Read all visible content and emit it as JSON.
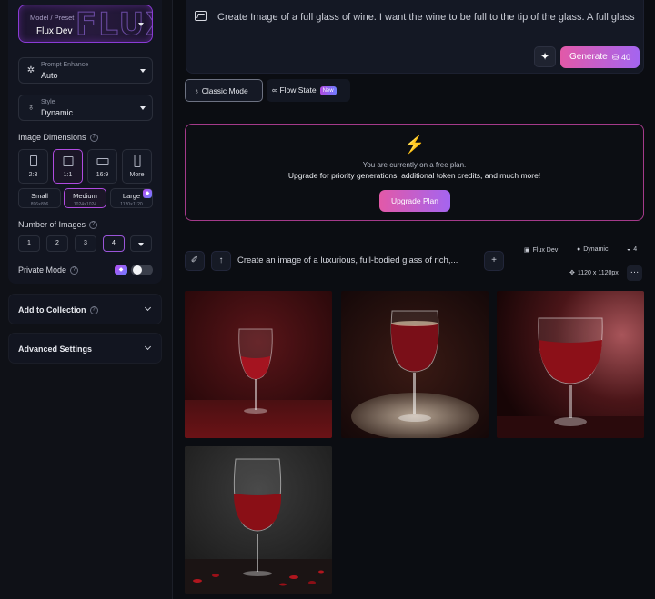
{
  "sidebar": {
    "model": {
      "label": "Model / Preset",
      "value": "Flux Dev"
    },
    "prompt_enhance": {
      "label": "Prompt Enhance",
      "value": "Auto"
    },
    "style": {
      "label": "Style",
      "value": "Dynamic"
    },
    "image_dimensions": {
      "title": "Image Dimensions",
      "ratios": [
        {
          "label": "2:3",
          "active": false
        },
        {
          "label": "1:1",
          "active": true
        },
        {
          "label": "16:9",
          "active": false
        },
        {
          "label": "More",
          "active": false
        }
      ],
      "sizes": [
        {
          "label": "Small",
          "px": "896×896",
          "active": false
        },
        {
          "label": "Medium",
          "px": "1024×1024",
          "active": true
        },
        {
          "label": "Large",
          "px": "1120×1120",
          "active": false
        }
      ]
    },
    "number_of_images": {
      "title": "Number of Images",
      "options": [
        "1",
        "2",
        "3",
        "4"
      ],
      "selected": "4"
    },
    "private_mode": {
      "label": "Private Mode",
      "enabled": false
    },
    "add_to_collection": "Add to Collection",
    "advanced_settings": "Advanced Settings"
  },
  "prompt": {
    "text": "Create Image of a full glass of wine. I want the wine to be full to the tip of the glass. A full glass",
    "generate_label": "Generate",
    "generate_cost": "40"
  },
  "modes": {
    "classic": "Classic Mode",
    "flow": "Flow State",
    "flow_badge": "New"
  },
  "upsell": {
    "line1": "You are currently on a free plan.",
    "line2": "Upgrade for priority generations, additional token credits, and much more!",
    "button": "Upgrade Plan"
  },
  "generation": {
    "prompt_preview": "Create an image of a luxurious, full-bodied glass of rich,...",
    "model": "Flux Dev",
    "style": "Dynamic",
    "count": "4",
    "resolution": "1120 x 1120px"
  },
  "colors": {
    "accent_pink": "#e259a8",
    "accent_purple": "#a465f0",
    "upsell_border": "#a43a8a",
    "bolt": "#f3d33a"
  }
}
